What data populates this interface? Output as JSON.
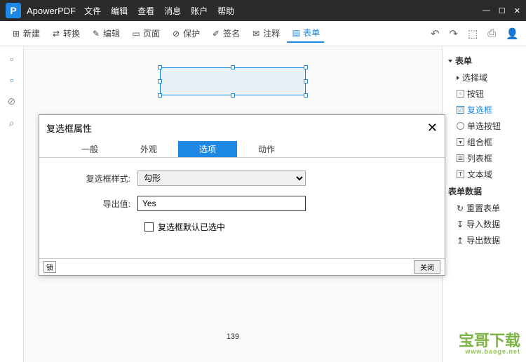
{
  "titlebar": {
    "app_name": "ApowerPDF",
    "logo_letter": "P"
  },
  "menu": {
    "file": "文件",
    "edit": "编辑",
    "view": "查看",
    "message": "消息",
    "account": "账户",
    "help": "帮助"
  },
  "toolbar": {
    "new": "新建",
    "convert": "转换",
    "edit": "编辑",
    "page": "页面",
    "protect": "保护",
    "sign": "签名",
    "annotate": "注释",
    "form": "表单"
  },
  "page_number": "139",
  "right_panel": {
    "section1_title": "表单",
    "items1": [
      "选择域",
      "按钮",
      "复选框",
      "单选按钮",
      "组合框",
      "列表框",
      "文本域"
    ],
    "section2_title": "表单数据",
    "items2": [
      "重置表单",
      "导入数据",
      "导出数据"
    ]
  },
  "dialog": {
    "title": "复选框属性",
    "tabs": {
      "general": "一般",
      "appearance": "外观",
      "options": "选项",
      "actions": "动作"
    },
    "style_label": "复选框样式:",
    "style_value": "勾形",
    "export_label": "导出值:",
    "export_value": "Yes",
    "default_checked_label": "复选框默认已选中",
    "footer_left": "锁",
    "close_btn": "关闭"
  },
  "watermark": {
    "main": "宝哥下载",
    "sub": "www.baoge.net"
  }
}
